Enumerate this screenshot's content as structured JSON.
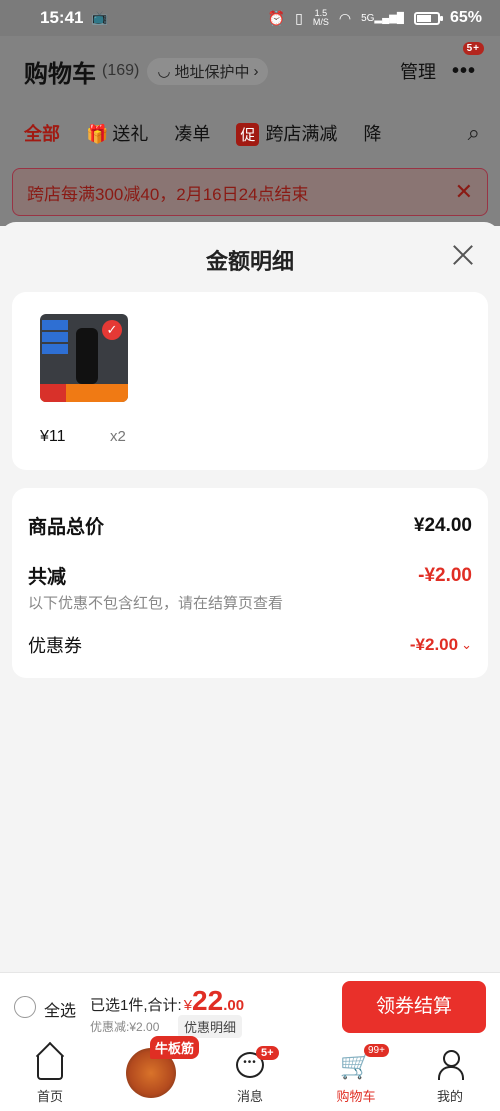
{
  "status_bar": {
    "time": "15:41",
    "net_speed_value": "1.5",
    "net_speed_unit": "M/S",
    "signal": "5G",
    "battery_percent": "65%",
    "battery_level": 0.65
  },
  "header": {
    "title": "购物车",
    "count": "(169)",
    "address_protect": "地址保护中",
    "manage": "管理",
    "more_badge": "5+"
  },
  "tabs": {
    "all": "全部",
    "gift": "送礼",
    "combine": "凑单",
    "cross_store_icon": "促",
    "cross_store": "跨店满减",
    "price_drop": "降"
  },
  "notice": {
    "text": "跨店每满300减40，2月16日24点结束"
  },
  "sheet": {
    "title": "金额明细",
    "product": {
      "price": "¥11",
      "qty": "x2"
    },
    "summary": {
      "total_label": "商品总价",
      "total_value": "¥24.00",
      "reduce_label": "共减",
      "reduce_value": "-¥2.00",
      "note": "以下优惠不包含红包，请在结算页查看",
      "coupon_label": "优惠券",
      "coupon_value": "-¥2.00"
    }
  },
  "checkout": {
    "select_all": "全选",
    "selected_text": "已选1件,合计:",
    "currency": "¥",
    "amount_int": "22",
    "amount_dec": ".00",
    "discount_text": "优惠减:¥2.00",
    "detail_button": "优惠明细",
    "pay_button": "领券结算"
  },
  "bottom_nav": {
    "home": "首页",
    "promo_tag": "牛板筋",
    "messages": "消息",
    "messages_badge": "5+",
    "cart": "购物车",
    "cart_badge": "99+",
    "me": "我的"
  },
  "colors": {
    "accent_red": "#e02e24",
    "pay_button": "#e9302a",
    "overlay_gray": "#828282"
  }
}
